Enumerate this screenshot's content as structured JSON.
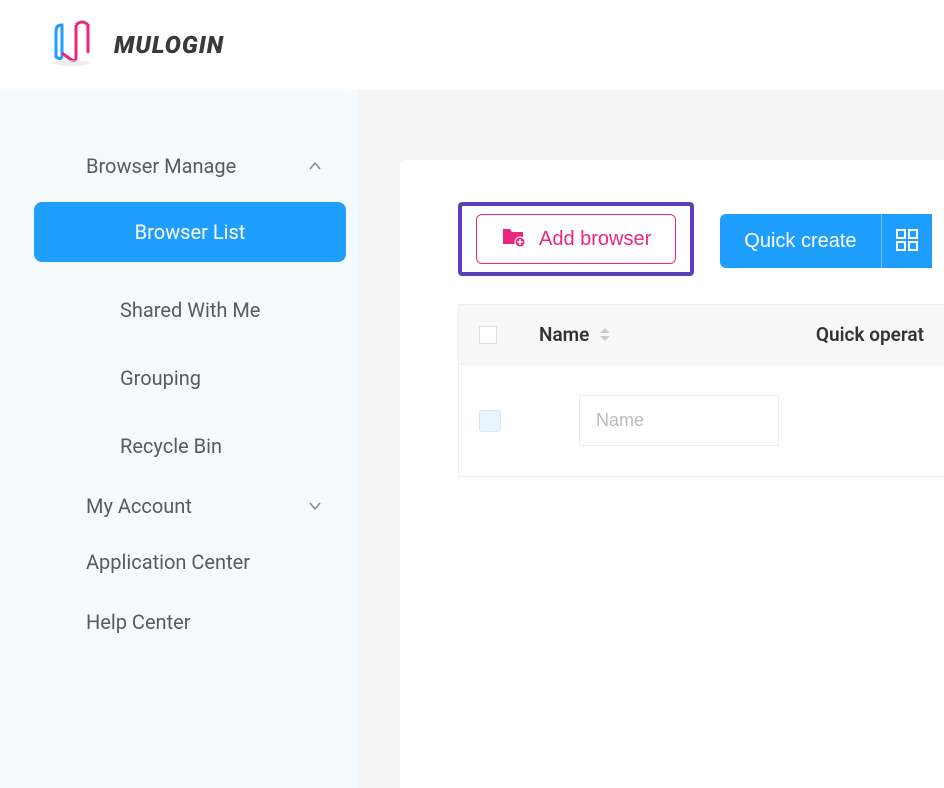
{
  "brand": {
    "name": "MULOGIN"
  },
  "sidebar": {
    "sections": [
      {
        "label": "Browser Manage",
        "expanded": true,
        "items": [
          {
            "label": "Browser List",
            "active": true
          },
          {
            "label": "Shared With Me",
            "active": false
          },
          {
            "label": "Grouping",
            "active": false
          },
          {
            "label": "Recycle Bin",
            "active": false
          }
        ]
      },
      {
        "label": "My Account",
        "expanded": false
      }
    ],
    "simple_items": [
      {
        "label": "Application Center"
      },
      {
        "label": "Help Center"
      }
    ]
  },
  "toolbar": {
    "add_browser_label": "Add browser",
    "quick_create_label": "Quick create"
  },
  "table": {
    "headers": {
      "name": "Name",
      "quick_operation": "Quick operat"
    },
    "name_placeholder": "Name"
  }
}
